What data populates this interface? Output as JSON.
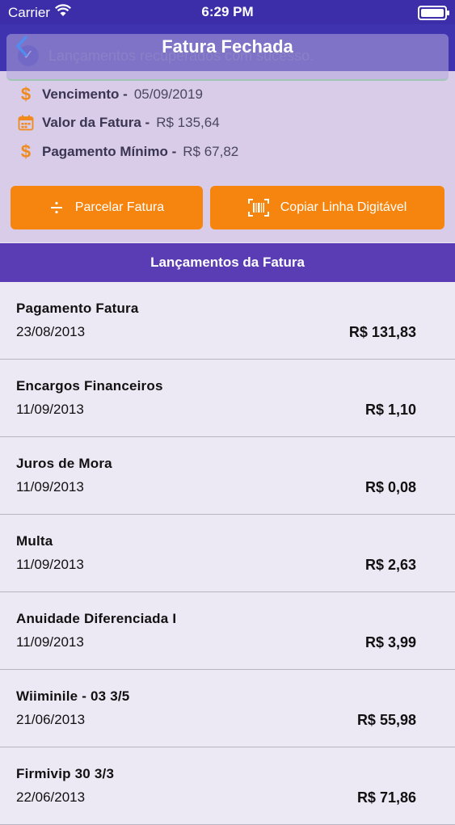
{
  "status": {
    "carrier": "Carrier",
    "time": "6:29 PM"
  },
  "nav": {
    "title": "Fatura Fechada",
    "back_icon": "chevron-left-icon"
  },
  "toast": {
    "text": "Lançamentos recuperados com sucesso."
  },
  "summary": {
    "due": {
      "label": "Vencimento -",
      "value": "05/09/2019",
      "icon": "dollar-icon"
    },
    "amount": {
      "label": "Valor da Fatura -",
      "value": "R$ 135,64",
      "icon": "calendar-icon"
    },
    "minimum": {
      "label": "Pagamento Mínimo -",
      "value": "R$ 67,82",
      "icon": "dollar-icon"
    }
  },
  "actions": {
    "installment_label": "Parcelar Fatura",
    "copy_label": "Copiar Linha Digitável"
  },
  "section": {
    "title": "Lançamentos da Fatura"
  },
  "transactions": [
    {
      "description": "Pagamento Fatura",
      "date": "23/08/2013",
      "amount": "R$ 131,83"
    },
    {
      "description": "Encargos Financeiros",
      "date": "11/09/2013",
      "amount": "R$ 1,10"
    },
    {
      "description": "Juros de Mora",
      "date": "11/09/2013",
      "amount": "R$ 0,08"
    },
    {
      "description": "Multa",
      "date": "11/09/2013",
      "amount": "R$ 2,63"
    },
    {
      "description": "Anuidade Diferenciada I",
      "date": "11/09/2013",
      "amount": "R$ 3,99"
    },
    {
      "description": "Wiiminile - 03 3/5",
      "date": "21/06/2013",
      "amount": "R$ 55,98"
    },
    {
      "description": "Firmivip 30 3/3",
      "date": "22/06/2013",
      "amount": "R$ 71,86"
    }
  ],
  "colors": {
    "accent": "#f5850e",
    "navbar": "#3f33b0",
    "section": "#5a3cb4"
  }
}
